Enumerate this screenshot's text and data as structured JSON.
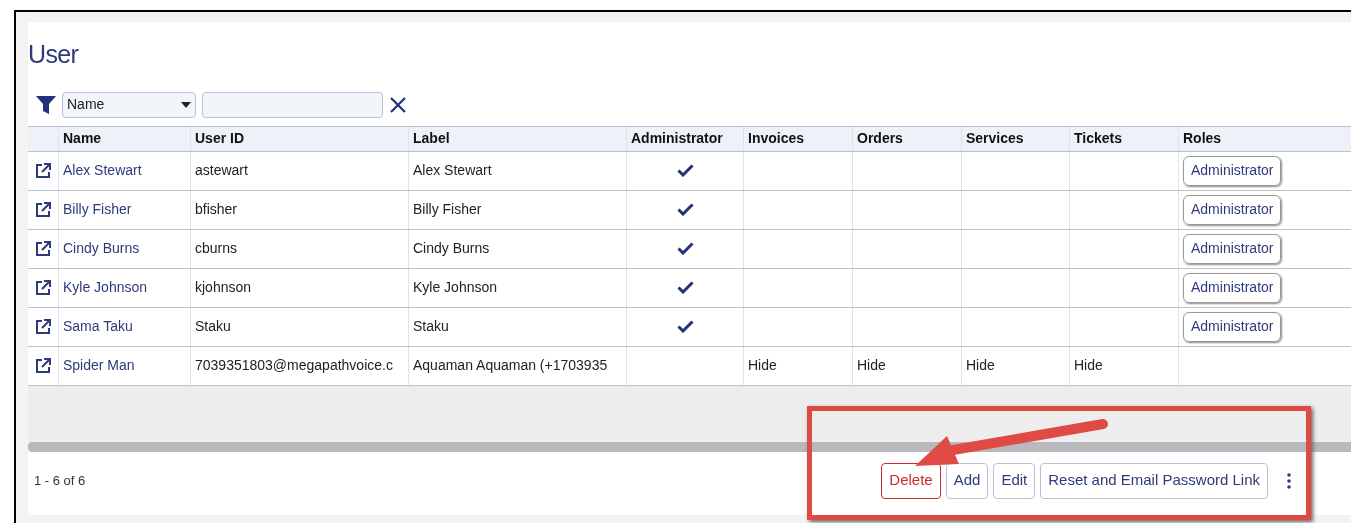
{
  "title": "User",
  "filter": {
    "field": "Name"
  },
  "table": {
    "columns": [
      "Name",
      "User ID",
      "Label",
      "Administrator",
      "Invoices",
      "Orders",
      "Services",
      "Tickets",
      "Roles"
    ],
    "rows": [
      {
        "name": "Alex Stewart",
        "user_id": "astewart",
        "label": "Alex Stewart",
        "administrator": true,
        "roles": [
          "Administrator"
        ]
      },
      {
        "name": "Billy Fisher",
        "user_id": "bfisher",
        "label": "Billy Fisher",
        "administrator": true,
        "roles": [
          "Administrator"
        ]
      },
      {
        "name": "Cindy Burns",
        "user_id": "cburns",
        "label": "Cindy Burns",
        "administrator": true,
        "roles": [
          "Administrator"
        ]
      },
      {
        "name": "Kyle Johnson",
        "user_id": "kjohnson",
        "label": "Kyle Johnson",
        "administrator": true,
        "roles": [
          "Administrator"
        ]
      },
      {
        "name": "Sama Taku",
        "user_id": "Staku",
        "label": "Staku",
        "administrator": true,
        "roles": [
          "Administrator"
        ]
      },
      {
        "name": "Spider Man",
        "user_id": "7039351803@megapathvoice.c",
        "label": "Aquaman Aquaman (+1703935",
        "administrator": false,
        "invoices": "Hide",
        "orders": "Hide",
        "services": "Hide",
        "tickets": "Hide"
      }
    ]
  },
  "pager": "1 - 6 of 6",
  "buttons": [
    {
      "label": "Delete",
      "kind": "danger"
    },
    {
      "label": "Add",
      "kind": "normal"
    },
    {
      "label": "Edit",
      "kind": "normal"
    },
    {
      "label": "Reset and Email Password Link",
      "kind": "normal"
    }
  ]
}
